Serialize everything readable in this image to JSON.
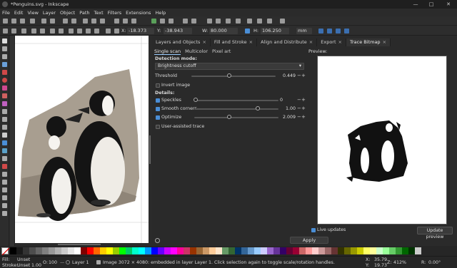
{
  "window": {
    "title": "*Penguins.svg - Inkscape"
  },
  "menu": [
    "File",
    "Edit",
    "View",
    "Layer",
    "Object",
    "Path",
    "Text",
    "Filters",
    "Extensions",
    "Help"
  ],
  "toolctl": {
    "x_label": "X:",
    "x_value": "-18.373",
    "y_label": "Y:",
    "y_value": "-38.943",
    "w_label": "W:",
    "w_value": "80.000",
    "h_label": "H:",
    "h_value": "106.250",
    "unit": "mm"
  },
  "dock_tabs": [
    {
      "label": "Layers and Objects",
      "active": false
    },
    {
      "label": "Fill and Stroke",
      "active": false
    },
    {
      "label": "Align and Distribute",
      "active": false
    },
    {
      "label": "Export",
      "active": false
    },
    {
      "label": "Trace Bitmap",
      "active": true
    }
  ],
  "trace": {
    "subtabs": [
      "Single scan",
      "Multicolor",
      "Pixel art"
    ],
    "detection_label": "Detection mode:",
    "detection_value": "Brightness cutoff",
    "threshold_label": "Threshold",
    "threshold_value": "0.449",
    "threshold_level": 0.449,
    "invert_label": "Invert image",
    "details_label": "Details:",
    "speckles_label": "Speckles",
    "speckles_value": "0",
    "smooth_label": "Smooth corners",
    "smooth_value": "1.00",
    "optimize_label": "Optimize",
    "optimize_value": "2.009",
    "assisted_label": "User-assisted trace",
    "preview_label": "Preview:",
    "live_label": "Live updates",
    "update_label": "Update preview",
    "apply_label": "Apply"
  },
  "status": {
    "fill_label": "Fill:",
    "fill_value": "Unset",
    "stroke_label": "Stroke:",
    "stroke_value": "Unset",
    "stroke_width": "1.00",
    "opacity_label": "O:",
    "opacity_value": "100",
    "layer_value": "Layer 1",
    "message": "Image 3072 × 4080: embedded in layer Layer 1. Click selection again to toggle scale/rotation handles.",
    "x_label": "X:",
    "x_value": "35.79",
    "y_label": "Y:",
    "y_value": "19.73",
    "zoom_label": "Z:",
    "zoom_value": "412%",
    "rot_label": "R:",
    "rot_value": "0.00°"
  },
  "palette_colors": [
    "#000000",
    "#1a1a1a",
    "#333333",
    "#4d4d4d",
    "#666666",
    "#808080",
    "#999999",
    "#b3b3b3",
    "#cccccc",
    "#e6e6e6",
    "#ffffff",
    "#800000",
    "#ff0000",
    "#ff6600",
    "#ffcc00",
    "#ffff00",
    "#99cc00",
    "#00ff00",
    "#00cc66",
    "#00ffcc",
    "#00ffff",
    "#0099ff",
    "#0000ff",
    "#6600ff",
    "#cc00ff",
    "#ff00ff",
    "#ff0099",
    "#cc3366",
    "#993300",
    "#996633",
    "#cc9966",
    "#ffcc99",
    "#ffe6cc",
    "#669966",
    "#336633",
    "#003366",
    "#336699",
    "#6699cc",
    "#99ccff",
    "#ccccff",
    "#9966cc",
    "#663399",
    "#330066",
    "#660033",
    "#990033",
    "#cc6666",
    "#ff9999",
    "#ffcccc",
    "#cc9999",
    "#996666",
    "#663333",
    "#333300",
    "#666600",
    "#999900",
    "#cccc00",
    "#ffff66",
    "#ffff99",
    "#ccffcc",
    "#99ff99",
    "#66cc66",
    "#339933",
    "#006600",
    "#003300",
    "#cccccc"
  ]
}
